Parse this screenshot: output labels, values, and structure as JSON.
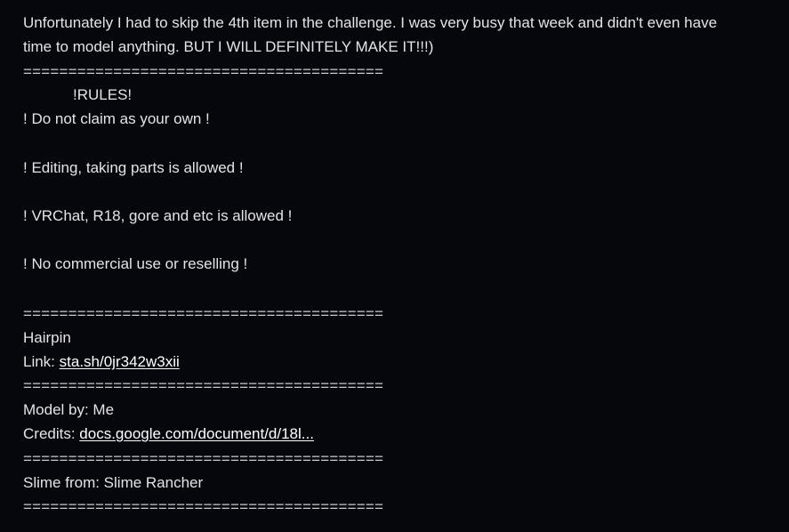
{
  "description": {
    "intro_line1": "Unfortunately I had to skip the 4th item in the challenge. I was very busy that week and didn't even have",
    "intro_line2": "time to model anything. BUT I WILL DEFINITELY MAKE IT!!!)",
    "separator": "========================================",
    "rules_heading": "!RULES!",
    "rules": [
      "! Do not claim as your own !",
      "! Editing, taking parts is allowed !",
      "! VRChat, R18, gore and etc is allowed !",
      "! No commercial use or reselling !"
    ],
    "item_name": "Hairpin",
    "link_label": "Link: ",
    "link_text": "sta.sh/0jr342w3xii",
    "model_by": "Model by: Me",
    "credits_label": "Credits: ",
    "credits_link_text": "docs.google.com/document/d/18l...",
    "slime_from": "Slime from: Slime Rancher"
  }
}
